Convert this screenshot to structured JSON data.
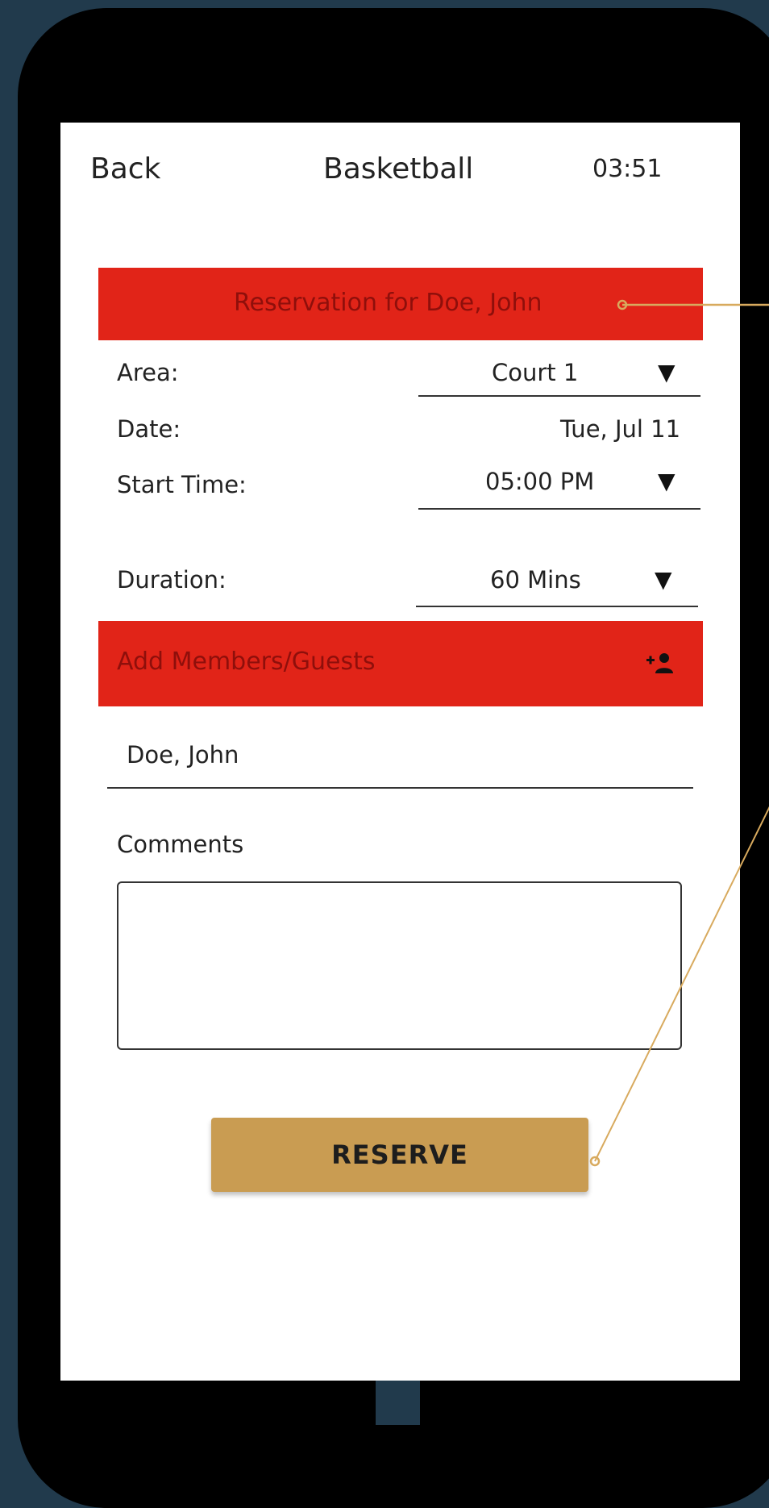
{
  "header": {
    "back_label": "Back",
    "title": "Basketball",
    "time": "03:51"
  },
  "reservation_banner": "Reservation for Doe, John",
  "form": {
    "area_label": "Area:",
    "area_value": "Court 1",
    "date_label": "Date:",
    "date_value": "Tue, Jul 11",
    "start_time_label": "Start Time:",
    "start_time_value": "05:00 PM",
    "duration_label": "Duration:",
    "duration_value": "60 Mins"
  },
  "members": {
    "banner_label": "Add Members/Guests",
    "add_icon": "add-person-icon",
    "member_name": "Doe, John"
  },
  "comments": {
    "label": "Comments",
    "value": ""
  },
  "reserve_label": "RESERVE",
  "colors": {
    "background": "#213a4c",
    "banner_red": "#e12418",
    "banner_text": "#8f0f0b",
    "button_gold": "#c99c52",
    "callout_line": "#d8aa5e"
  }
}
